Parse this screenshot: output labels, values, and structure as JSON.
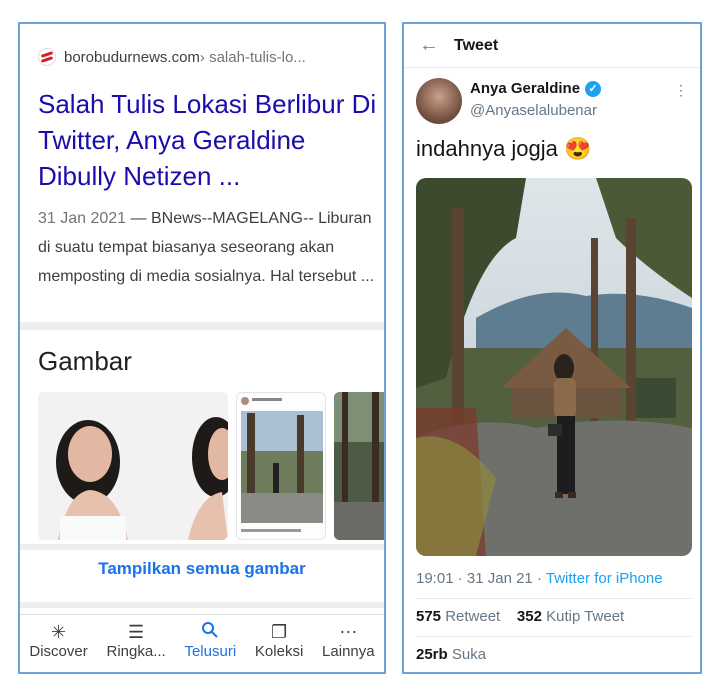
{
  "search_result": {
    "site": "borobudurnews.com",
    "path": " › salah-tulis-lo...",
    "title": "Salah Tulis Lokasi Berlibur Di Twitter, Anya Geraldine Dibully Netizen ...",
    "date": "31 Jan 2021",
    "snippet": " — BNews--MAGELANG-- Liburan di suatu tempat biasanya seseorang akan memposting di media sosialnya. Hal tersebut ..."
  },
  "images_section": {
    "heading": "Gambar",
    "show_all": "Tampilkan semua gambar"
  },
  "bottom_nav": [
    {
      "icon": "asterisk-icon",
      "glyph": "✳",
      "label": "Discover"
    },
    {
      "icon": "summary-icon",
      "glyph": "☰",
      "label": "Ringka..."
    },
    {
      "icon": "search-icon",
      "glyph": "🔍",
      "label": "Telusuri"
    },
    {
      "icon": "collections-icon",
      "glyph": "❐",
      "label": "Koleksi"
    },
    {
      "icon": "more-icon",
      "glyph": "⋯",
      "label": "Lainnya"
    }
  ],
  "tweet": {
    "header_title": "Tweet",
    "display_name": "Anya Geraldine",
    "handle": "@Anyaselalubenar",
    "text": "indahnya jogja 😍",
    "time": "19:01",
    "date": "31 Jan 21",
    "client": "Twitter for iPhone",
    "retweets": "575",
    "retweets_label": " Retweet",
    "quotes": "352",
    "quotes_label": " Kutip Tweet",
    "likes": "25rb",
    "likes_label": " Suka"
  },
  "colors": {
    "link_blue": "#1a0dab",
    "google_blue": "#1a73e8",
    "twitter_blue": "#1da1f2",
    "panel_border": "#6fa4d9"
  }
}
